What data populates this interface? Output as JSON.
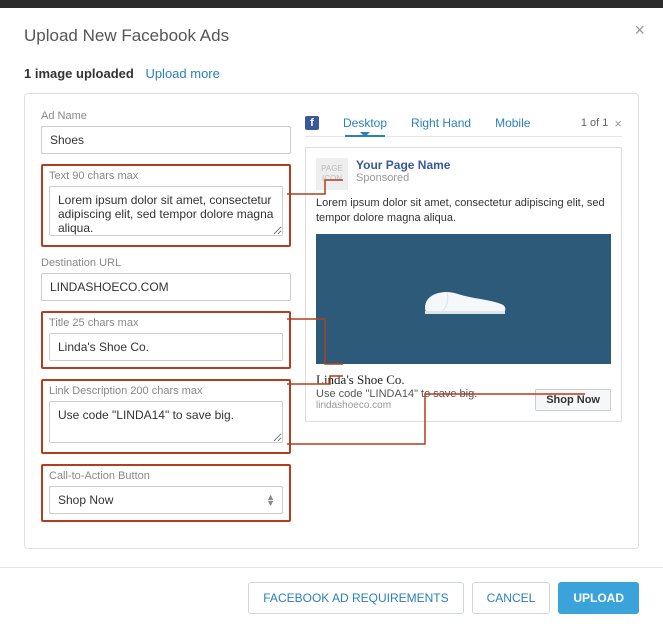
{
  "header": {
    "title": "Upload New Facebook Ads"
  },
  "upload": {
    "status_bold": "1 image uploaded",
    "more": "Upload more"
  },
  "form": {
    "adName": {
      "label": "Ad Name",
      "value": "Shoes"
    },
    "text": {
      "label": "Text 90 chars max",
      "value": "Lorem ipsum dolor sit amet, consectetur adipiscing elit, sed tempor dolore magna aliqua."
    },
    "destUrl": {
      "label": "Destination URL",
      "value": "LINDASHOECO.COM"
    },
    "title": {
      "label": "Title 25 chars max",
      "value": "Linda's Shoe Co."
    },
    "linkDesc": {
      "label": "Link Description 200 chars max",
      "value": "Use code \"LINDA14\" to save big."
    },
    "cta": {
      "label": "Call-to-Action Button",
      "value": "Shop Now"
    }
  },
  "preview": {
    "tabs": {
      "desktop": "Desktop",
      "righthand": "Right Hand",
      "mobile": "Mobile"
    },
    "counter": "1 of 1",
    "pageIcon": "PAGE ICON",
    "pageName": "Your Page Name",
    "sponsored": "Sponsored",
    "text": "Lorem ipsum dolor sit amet, consectetur adipiscing elit, sed tempor dolore magna aliqua.",
    "title": "Linda's Shoe Co.",
    "desc": "Use code \"LINDA14\" to save big.",
    "domain": "lindashoeco.com",
    "cta": "Shop Now"
  },
  "footer": {
    "req": "FACEBOOK AD REQUIREMENTS",
    "cancel": "CANCEL",
    "upload": "UPLOAD"
  }
}
